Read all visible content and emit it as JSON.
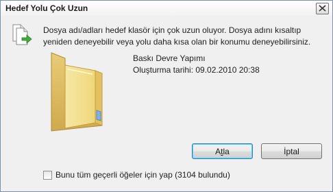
{
  "window": {
    "title": "Hedef Yolu Çok Uzun"
  },
  "message": "Dosya adı/adları hedef klasör için çok uzun oluyor.  Dosya adını kısaltıp yeniden deneyebilir veya yolu daha kısa olan bir konumu deneyebilirsiniz.",
  "file": {
    "name": "Baskı Devre Yapımı",
    "created": "Oluşturma tarihi: 09.02.2010 20:38"
  },
  "buttons": {
    "skip": "Atla",
    "cancel": "İptal"
  },
  "checkbox": {
    "label": "Bunu tüm geçerli öğeler için yap (3104 bulundu)",
    "checked": false
  },
  "icons": {
    "close": "close-icon",
    "dialog": "file-move-icon",
    "folder": "folder-icon"
  }
}
